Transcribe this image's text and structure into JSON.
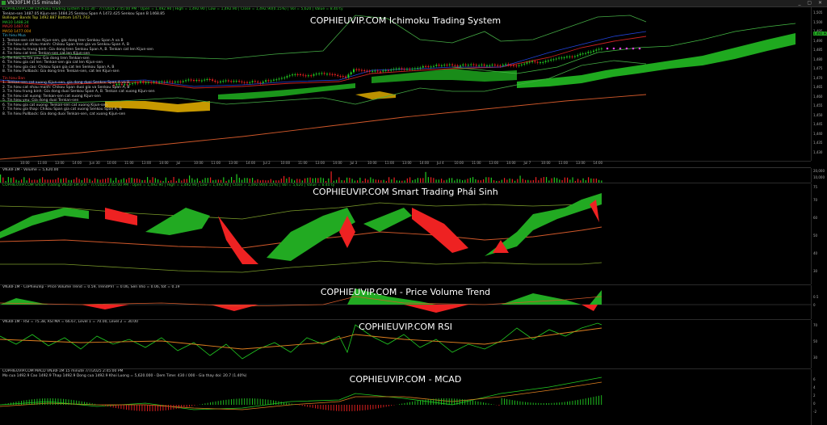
{
  "window": {
    "title": "VN30F1M (15 minute)",
    "controls": "_ ▢ ✕"
  },
  "pane1": {
    "title": "COPHIEUVIP.COM Ichimoku Trading System",
    "header": "COPHIEUVIP.COM Ichimoku trading system 4-11-30 - 7/7/2025 2:45:00 PM : Open = 1,492.90 | High = 1,492.90 | Low = 1,492.90 | Close = 1,492.90(0.15%) | Vol = 5,620 | Value = 8.40 ty",
    "info_lines": [
      "Tenkan-sen 1487.05  Kijun-sen 1484.25  Senkou Span A 1472.425  Senkou Span B 1468.85",
      "Bollinger Bands Top 1492.887  Bottom 1471.743",
      "MA10 1488.24",
      "MA20 1487.04",
      "MA50 1477.004"
    ],
    "buy_header": "Tin hieu Mua",
    "buy_lines": [
      "1. Tenkan-sen cat len Kijun-sen, gia dong tren Senkou Span A va B",
      "2. Tin hieu cat nhau manh: Chikou Span tren gia va Senkou Span A, B",
      "3. Tin hieu tu trung binh: Gia dong tren Senkou Span A, B. Tenkan cat len Kijun-sen",
      "4. Tin hieu cat tren Tenkan-sen cat len Kijun-sen",
      "5. Tin hieu tu tre yeu: Gia dong tren Tenkan-sen",
      "6. Tin hieu gia cat len: Tenkan-sen gia cat len Kijun-sen",
      "7. Tin hieu gia cao: Chikou Span gia cat len Senkou Span A, B",
      "8. Tin hieu Pullback: Gia dong tren Tenkan-sen, cat len Kijun-sen"
    ],
    "sell_header": "Tin hieu Ban",
    "sell_lines": [
      "1. Tenkan-sen cat xuong Kijun-sen, gia dong duoi Senkou Span A va B",
      "2. Tin hieu cat nhau manh: Chikou Span duoi gia va Senkou Span A, B",
      "3. Tin hieu trung binh: Gia dong duoi Senkou Span A, B. Tenkan cat xuong Kijun-sen",
      "4. Tin hieu cat xuong: Tenkan-sen cat xuong Kijun-sen",
      "5. Tin hieu yeu: Gia dong duoi Tenkan-sen",
      "6. Tin hieu gia cat xuong: Tenkan-sen cat xuong Kijun-sen",
      "7. Tin hieu gia thap: Chikou Span gia cat xuong Senkou Span A, B",
      "8. Tin hieu Pullback: Gia dong duoi Tenkan-sen, cat xuong Kijun-sen"
    ],
    "price_ticks": [
      "1,505",
      "1,500",
      "1,495",
      "1,490",
      "1,485",
      "1,480",
      "1,475",
      "1,470",
      "1,465",
      "1,460",
      "1,455",
      "1,450",
      "1,445",
      "1,440",
      "1,435",
      "1,430"
    ],
    "last_price": "1,492.90"
  },
  "time_axis": [
    "10:00",
    "11:00",
    "13:00",
    "14:00",
    "Jun 30",
    "10:00",
    "11:00",
    "13:00",
    "14:00",
    "Jul",
    "10:00",
    "11:00",
    "13:00",
    "14:00",
    "Jul 2",
    "10:00",
    "11:00",
    "13:00",
    "14:00",
    "Jul 3",
    "10:00",
    "11:00",
    "13:00",
    "14:00",
    "Jul 4",
    "10:00",
    "11:00",
    "13:00",
    "14:00",
    "Jul 7",
    "10:00",
    "11:00",
    "13:00",
    "14:00"
  ],
  "volume_pane": {
    "header": "VN30F1M - Volume = 5,620.00",
    "ticks": [
      "20,000",
      "10,000"
    ]
  },
  "pane2": {
    "title": "COPHIEUVIP.COM Smart Trading Phái Sinh",
    "header": "COPHIEUVIP.COM Smart Trading VN30F1M.Vnx - 7/7/2025 2:45:00 PM : Open = 1,492.90 | High = 1,492.90 | Low = 1,492.90 | Close = 1,492.90(0.15%) | Vol = 5,620 | Value = 8.40 ty",
    "ticks": [
      "75",
      "70",
      "60",
      "50",
      "40",
      "30"
    ]
  },
  "pane3": {
    "title": "COPHIEUVIP.COM - Price Volume Trend",
    "header": "VN30F1M - CoPhieuVip - Price Volume Trend = 0.59, TrendPVT = 0.06, Sen nho = 0.06, tot = 0.19",
    "ticks": [
      "0.5",
      "0"
    ]
  },
  "pane4": {
    "title": "COPHIEUVIP.COM RSI",
    "header": "VN30F1M - RSI = 75.38, RSI MA = 66.67, Level 1 = 70.00, Level 2 = 30.00",
    "ticks": [
      "70",
      "50",
      "30"
    ]
  },
  "pane5": {
    "title": "COPHIEUVIP.COM - MCAD",
    "header": "COPHIEUVIP.COM MACD   VN30F1M   15 minute   7/7/2025 2:45:00 PM",
    "header2": "Mo cua 1492.9  Cao 1492.9  Thap 1492.9  Dong cua 1492.9  Khoi Luong = 5,620.000 - Dem Time: 430 / 000 - Gia thay doi: 20.7 (1.40%)",
    "ticks": [
      "6",
      "4",
      "2",
      "0",
      "-2"
    ]
  },
  "colors": {
    "up": "#22cc22",
    "down": "#ee2222",
    "cloud_bull": "#22bb22",
    "cloud_bear": "#ddaa00",
    "bg": "#000000"
  }
}
